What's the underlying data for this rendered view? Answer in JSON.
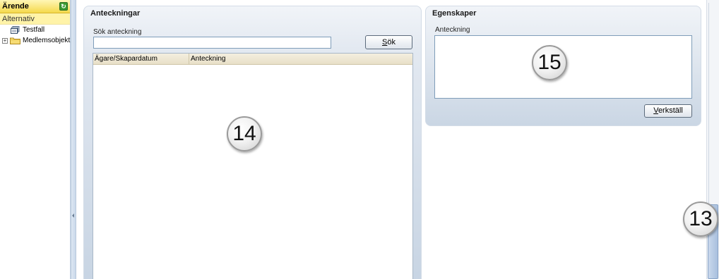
{
  "nav": {
    "title": "Ärende",
    "section": "Alternativ",
    "tree": [
      {
        "label": "Testfall",
        "icon": "document-stack-icon"
      },
      {
        "label": "Medlemsobjekt",
        "icon": "folder-icon",
        "expander": "+"
      }
    ]
  },
  "notes": {
    "title": "Anteckningar",
    "search_label": "Sök anteckning",
    "search_value": "",
    "search_button": {
      "accesskey": "S",
      "rest": "ök"
    },
    "columns": [
      "Ägare/Skapardatum",
      "Anteckning"
    ],
    "rows": []
  },
  "properties": {
    "title": "Egenskaper",
    "note_label": "Anteckning",
    "note_value": "",
    "apply_button": {
      "accesskey": "V",
      "rest": "erkställ"
    }
  },
  "callouts": {
    "notes": "14",
    "properties": "15",
    "scrollbar": "13"
  },
  "colors": {
    "nav_header": "#f5d94c",
    "panel_bg": "#e3e9f1",
    "accent_border": "#7f9db9"
  }
}
